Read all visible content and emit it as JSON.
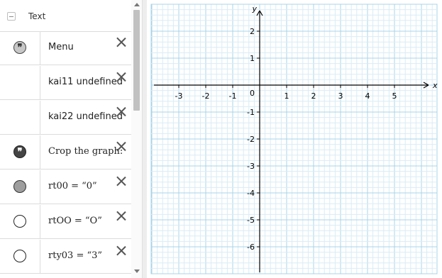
{
  "algebra": {
    "header_title": "Text",
    "rows": [
      {
        "text": "Menu",
        "marble": "quote-light"
      },
      {
        "text": "kai11 undefined",
        "marble": "none"
      },
      {
        "text": "kai22 undefined",
        "marble": "none"
      },
      {
        "text": "Crop the graph:",
        "marble": "quote-dark"
      },
      {
        "text": "rt00 = “0”",
        "marble": "gray"
      },
      {
        "text": "rtOO = “O”",
        "marble": "white"
      },
      {
        "text": "rty03 = “3”",
        "marble": "white"
      }
    ]
  },
  "graphics": {
    "x_axis_label": "x",
    "y_axis_label": "y",
    "origin_label": "0",
    "x_ticks": [
      -3,
      -2,
      -1,
      1,
      2,
      3,
      4,
      5
    ],
    "y_ticks": [
      2,
      1,
      -1,
      -2,
      -3,
      -4,
      -5,
      -6
    ],
    "x_range": [
      -4.0,
      6.5
    ],
    "y_range": [
      -7.0,
      3.1
    ],
    "grid_color_major": "#a9d4e8",
    "grid_color_minor": "#d9edf6",
    "quote_symbol": "❞"
  }
}
